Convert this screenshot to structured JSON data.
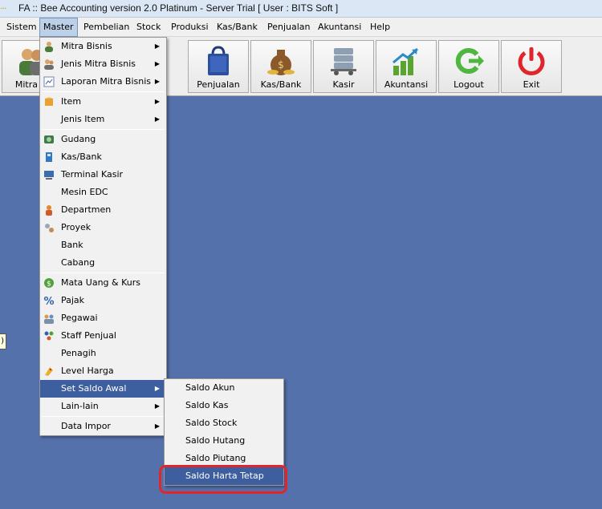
{
  "window": {
    "title": "FA :: Bee Accounting version 2.0 Platinum - Server Trial [ User : BITS Soft ]",
    "dots": "···"
  },
  "menubar": [
    "Sistem",
    "Master",
    "Pembelian",
    "Stock",
    "Produksi",
    "Kas/Bank",
    "Penjualan",
    "Akuntansi",
    "Help"
  ],
  "toolbar": [
    "Mitra Bi",
    "Penjualan",
    "Kas/Bank",
    "Kasir",
    "Akuntansi",
    "Logout",
    "Exit"
  ],
  "tooltip": ":)",
  "master_menu": [
    {
      "label": "Mitra Bisnis",
      "icon": "people-icon",
      "arrow": true
    },
    {
      "label": "Jenis Mitra Bisnis",
      "icon": "people-group-icon",
      "arrow": true
    },
    {
      "label": "Laporan Mitra Bisnis",
      "icon": "report-icon",
      "arrow": true
    },
    {
      "label": "Item",
      "icon": "box-icon",
      "arrow": true
    },
    {
      "label": "Jenis Item",
      "icon": "",
      "arrow": true
    },
    {
      "label": "Gudang",
      "icon": "warehouse-icon",
      "arrow": false
    },
    {
      "label": "Kas/Bank",
      "icon": "cash-icon",
      "arrow": false
    },
    {
      "label": "Terminal Kasir",
      "icon": "terminal-icon",
      "arrow": false
    },
    {
      "label": "Mesin EDC",
      "icon": "",
      "arrow": false
    },
    {
      "label": "Departmen",
      "icon": "department-icon",
      "arrow": false
    },
    {
      "label": "Proyek",
      "icon": "project-icon",
      "arrow": false
    },
    {
      "label": "Bank",
      "icon": "",
      "arrow": false
    },
    {
      "label": "Cabang",
      "icon": "",
      "arrow": false
    },
    {
      "label": "Mata Uang & Kurs",
      "icon": "currency-icon",
      "arrow": false
    },
    {
      "label": "Pajak",
      "icon": "percent-icon",
      "arrow": false
    },
    {
      "label": "Pegawai",
      "icon": "employee-icon",
      "arrow": false
    },
    {
      "label": "Staff Penjual",
      "icon": "staff-icon",
      "arrow": false
    },
    {
      "label": "Penagih",
      "icon": "",
      "arrow": false
    },
    {
      "label": "Level Harga",
      "icon": "price-tag-icon",
      "arrow": false
    },
    {
      "label": "Set Saldo Awal",
      "icon": "",
      "arrow": true,
      "highlighted": true
    },
    {
      "label": "Lain-lain",
      "icon": "",
      "arrow": true
    },
    {
      "label": "Data Impor",
      "icon": "",
      "arrow": true
    }
  ],
  "saldo_submenu": [
    "Saldo Akun",
    "Saldo Kas",
    "Saldo Stock",
    "Saldo Hutang",
    "Saldo Piutang",
    "Saldo Harta Tetap"
  ],
  "colors": {
    "desktop": "#5471ab",
    "highlight": "#3d5f9f",
    "callout": "#e0262c"
  }
}
